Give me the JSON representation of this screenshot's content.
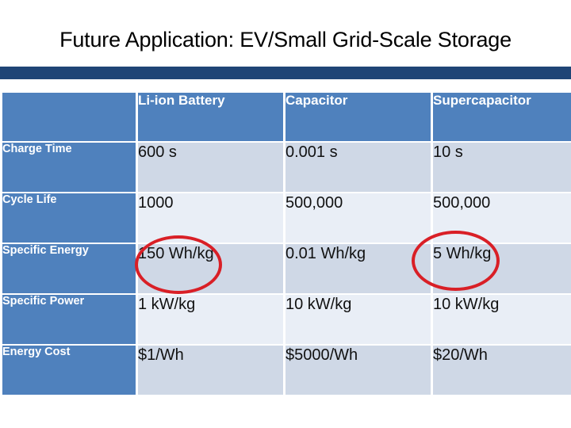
{
  "slide": {
    "title": "Future Application: EV/Small Grid-Scale Storage",
    "accent_bar_color": "#1F4576",
    "header_fill_color": "#4F81BD",
    "row_band_dark_color": "#CFD8E6",
    "row_band_light_color": "#E9EEF6",
    "annotation_color": "#D91F26"
  },
  "table": {
    "corner_label": "",
    "columns": [
      "Li-ion Battery",
      "Capacitor",
      "Supercapacitor"
    ],
    "rows": [
      {
        "label": "Charge Time",
        "values": [
          "600 s",
          "0.001 s",
          "10 s"
        ]
      },
      {
        "label": "Cycle Life",
        "values": [
          "1000",
          "500,000",
          "500,000"
        ]
      },
      {
        "label": "Specific Energy",
        "values": [
          "150 Wh/kg",
          "0.01 Wh/kg",
          "5 Wh/kg"
        ]
      },
      {
        "label": "Specific Power",
        "values": [
          "1 kW/kg",
          "10 kW/kg",
          "10 kW/kg"
        ]
      },
      {
        "label": "Energy Cost",
        "values": [
          "$1/Wh",
          "$5000/Wh",
          "$20/Wh"
        ]
      }
    ]
  },
  "annotations": [
    {
      "name": "circle-li-ion-specific-energy",
      "target_value": "150 Wh/kg"
    },
    {
      "name": "circle-supercapacitor-specific-energy",
      "target_value": "5 Wh/kg"
    }
  ]
}
